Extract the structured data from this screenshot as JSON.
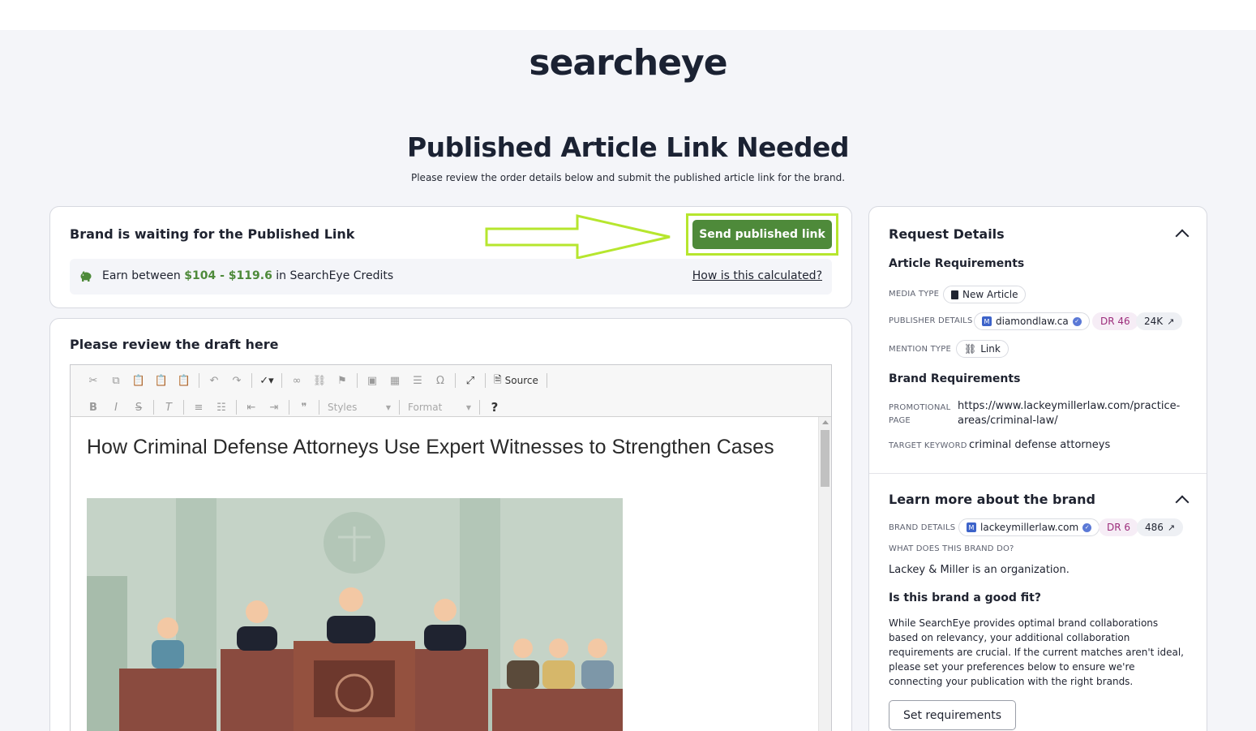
{
  "app": {
    "logo_text": "searcheye",
    "page_title": "Published Article Link Needed",
    "page_subtitle": "Please review the order details below and submit the published article link for the brand."
  },
  "waiting_card": {
    "title": "Brand is waiting for the Published Link",
    "send_button": "Send published link",
    "earn_prefix": "Earn between ",
    "earn_min": "$104",
    "earn_sep": " - ",
    "earn_max": "$119.6",
    "earn_suffix": " in SearchEye Credits",
    "calc_link": "How is this calculated?"
  },
  "draft_card": {
    "title": "Please review the draft here",
    "toolbar": {
      "source_label": "Source",
      "styles_label": "Styles",
      "format_label": "Format",
      "help_label": "?"
    },
    "article_title": "How Criminal Defense Attorneys Use Expert Witnesses to Strengthen Cases"
  },
  "request_details": {
    "title": "Request Details",
    "article_requirements": "Article Requirements",
    "media_type_label": "MEDIA TYPE",
    "media_type_value": "New Article",
    "publisher_label": "PUBLISHER DETAILS",
    "publisher_domain": "diamondlaw.ca",
    "publisher_dr": "DR 46",
    "publisher_traffic": "24K",
    "mention_label": "MENTION TYPE",
    "mention_value": "Link",
    "brand_requirements": "Brand Requirements",
    "promo_label_1": "PROMOTIONAL",
    "promo_label_2": "PAGE",
    "promo_value_1": "https://www.lackeymillerlaw.com/practice-",
    "promo_value_2": "areas/criminal-law/",
    "keyword_label": "TARGET KEYWORD",
    "keyword_value": "criminal defense attorneys"
  },
  "brand_section": {
    "title": "Learn more about the brand",
    "brand_label": "BRAND DETAILS",
    "brand_domain": "lackeymillerlaw.com",
    "brand_dr": "DR 6",
    "brand_traffic": "486",
    "what_label": "WHAT DOES THIS BRAND DO?",
    "what_value": "Lackey & Miller is an organization.",
    "fit_title": "Is this brand a good fit?",
    "fit_text": "While SearchEye provides optimal brand collaborations based on relevancy, your additional collaboration requirements are crucial. If the current matches aren't ideal, please set your preferences below to ensure we're connecting your publication with the right brands.",
    "set_requirements_button": "Set requirements"
  },
  "colors": {
    "accent_green": "#4e8a3a",
    "highlight": "#b6e62e",
    "dr_badge": "#9c2c7b"
  }
}
